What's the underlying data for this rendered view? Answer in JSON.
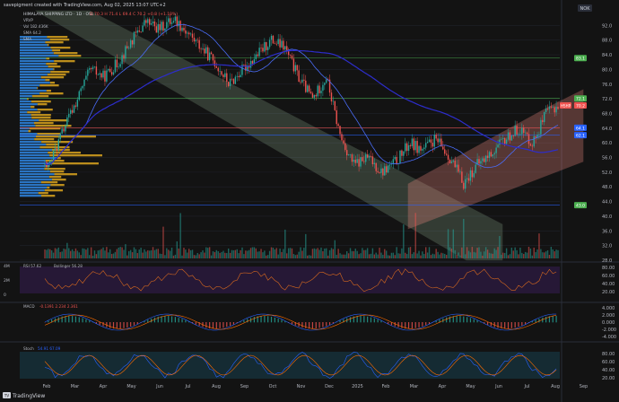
{
  "header": {
    "created_by": "savepigment created with TradingView.com, Aug 02, 2025 13:07 UTC+2",
    "legend_title": "HIMALAYA SHIPPING LTD · 1D · OSL",
    "legend_quote": "O 70.3 H 71.4 L 69.4 C 70.2 +0.8 (+1.13%)",
    "currency": "NOK",
    "indicators": [
      "VRVP",
      "Vol 182.436K",
      "SMA 64.2",
      "SMA"
    ]
  },
  "brand": {
    "logo_text": "TradingView",
    "logo_symbol": "TV"
  },
  "colors": {
    "background": "#131313",
    "up": "#26a69a",
    "down": "#ef5350",
    "sma_fast": "#4a6cf7",
    "sma_slow": "#2d2dcc",
    "channel_green": "#a5c8a5",
    "channel_red": "#f28b82",
    "profile_blue": "#2e7fd6",
    "profile_gold": "#d9a31e",
    "rsi_line": "#d96a1e",
    "macd_line": "#2962ff",
    "signal_line": "#ff6d00",
    "stoch_k": "#2962ff",
    "stoch_d": "#ff6d00"
  },
  "price_axis": {
    "ticks": [
      "92.0",
      "88.0",
      "84.0",
      "80.0",
      "76.0",
      "72.0",
      "68.0",
      "64.0",
      "60.0",
      "56.0",
      "52.0",
      "48.0",
      "44.0",
      "40.0",
      "36.0",
      "32.0",
      "28.0"
    ],
    "labels": [
      {
        "text": "83.1",
        "value": 83.1,
        "color": "#4caf50"
      },
      {
        "text": "72.1",
        "value": 72.1,
        "color": "#4caf50"
      },
      {
        "text": "70.2",
        "value": 70.2,
        "color": "#ef5350"
      },
      {
        "text": "64.1",
        "value": 64.1,
        "color": "#2962ff"
      },
      {
        "text": "62.1",
        "value": 62.1,
        "color": "#2962ff"
      },
      {
        "text": "43.0",
        "value": 43.0,
        "color": "#4caf50"
      }
    ],
    "last_price_tag": "HSHP"
  },
  "time_axis": [
    "Feb",
    "Mar",
    "Apr",
    "May",
    "Jun",
    "Jul",
    "Aug",
    "Sep",
    "Oct",
    "Nov",
    "Dec",
    "2025",
    "Feb",
    "Mar",
    "Apr",
    "May",
    "Jun",
    "Jul",
    "Aug",
    "Sep"
  ],
  "volume_axis": [
    "4M",
    "2M",
    "0"
  ],
  "rsi": {
    "legend": "RSI 57.62",
    "legend2": "Bollinger 56.28",
    "ticks": [
      "80.00",
      "60.00",
      "40.00",
      "20.00"
    ]
  },
  "macd": {
    "legend": "MACD",
    "values": "-0.1391 2.234 2.361",
    "ticks": [
      "4.000",
      "2.000",
      "0.000",
      "-2.000",
      "-4.000"
    ]
  },
  "stoch": {
    "legend": "Stoch",
    "values": "54.91 67.09",
    "ticks": [
      "80.00",
      "60.00",
      "40.00",
      "20.00"
    ]
  },
  "chart_data": {
    "type": "candlestick",
    "title": "HIMALAYA SHIPPING LTD · 1D · OSL",
    "ylim": [
      28,
      96
    ],
    "x_period": [
      "2024-01",
      "2025-08"
    ],
    "close_path": [
      {
        "date": "2024-01-20",
        "close": 54
      },
      {
        "date": "2024-02-05",
        "close": 64
      },
      {
        "date": "2024-02-20",
        "close": 72
      },
      {
        "date": "2024-03-05",
        "close": 80
      },
      {
        "date": "2024-03-20",
        "close": 78
      },
      {
        "date": "2024-04-05",
        "close": 82
      },
      {
        "date": "2024-04-20",
        "close": 88
      },
      {
        "date": "2024-05-05",
        "close": 93
      },
      {
        "date": "2024-05-20",
        "close": 91
      },
      {
        "date": "2024-06-05",
        "close": 94
      },
      {
        "date": "2024-06-20",
        "close": 90
      },
      {
        "date": "2024-07-05",
        "close": 86
      },
      {
        "date": "2024-07-20",
        "close": 82
      },
      {
        "date": "2024-08-05",
        "close": 76
      },
      {
        "date": "2024-08-20",
        "close": 80
      },
      {
        "date": "2024-09-05",
        "close": 84
      },
      {
        "date": "2024-09-20",
        "close": 88
      },
      {
        "date": "2024-10-05",
        "close": 86
      },
      {
        "date": "2024-10-20",
        "close": 78
      },
      {
        "date": "2024-11-05",
        "close": 72
      },
      {
        "date": "2024-11-20",
        "close": 78
      },
      {
        "date": "2024-12-05",
        "close": 62
      },
      {
        "date": "2024-12-20",
        "close": 54
      },
      {
        "date": "2025-01-05",
        "close": 56
      },
      {
        "date": "2025-01-20",
        "close": 52
      },
      {
        "date": "2025-02-05",
        "close": 55
      },
      {
        "date": "2025-02-20",
        "close": 60
      },
      {
        "date": "2025-03-05",
        "close": 58
      },
      {
        "date": "2025-03-20",
        "close": 61
      },
      {
        "date": "2025-04-05",
        "close": 56
      },
      {
        "date": "2025-04-20",
        "close": 49
      },
      {
        "date": "2025-05-05",
        "close": 54
      },
      {
        "date": "2025-05-20",
        "close": 57
      },
      {
        "date": "2025-06-05",
        "close": 61
      },
      {
        "date": "2025-06-20",
        "close": 64
      },
      {
        "date": "2025-07-05",
        "close": 60
      },
      {
        "date": "2025-07-20",
        "close": 68
      },
      {
        "date": "2025-08-01",
        "close": 70.2
      }
    ],
    "horizontal_levels": [
      83.1,
      72.1,
      64.1,
      62.1,
      43.0
    ]
  }
}
